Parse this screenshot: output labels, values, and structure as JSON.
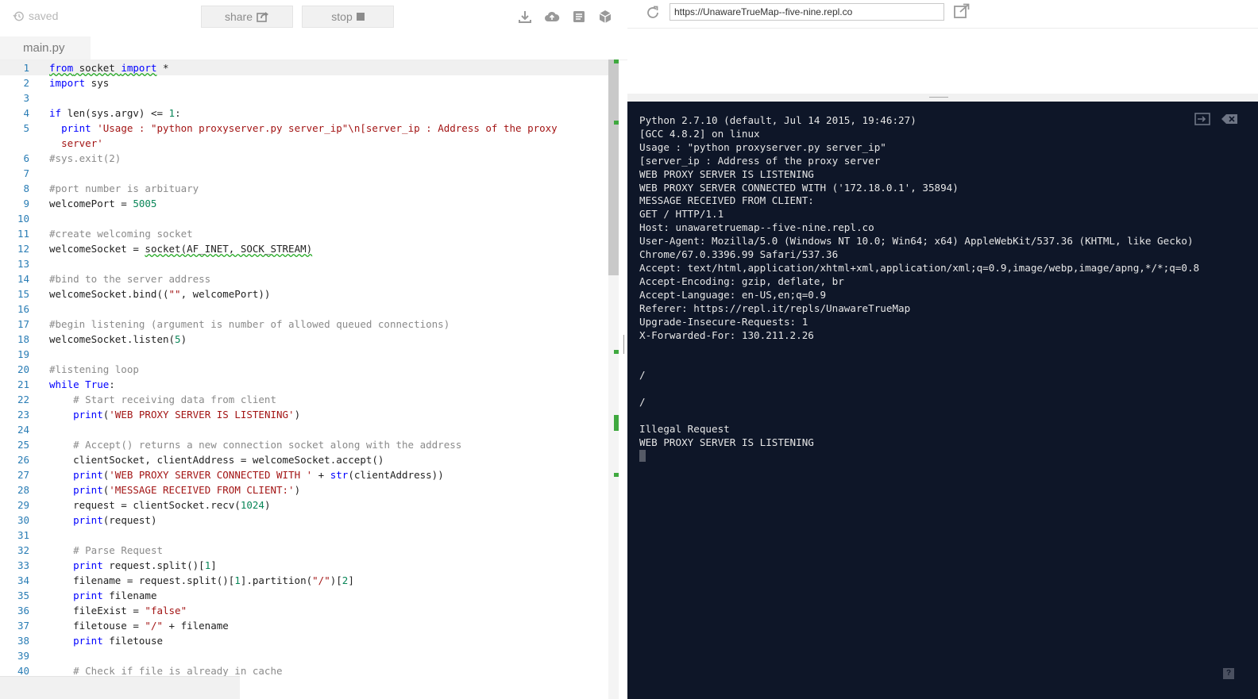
{
  "topbar": {
    "saved_label": "saved",
    "share_label": "share",
    "stop_label": "stop",
    "tools": [
      "download-icon",
      "cloud-upload-icon",
      "notes-icon",
      "package-icon"
    ]
  },
  "file_tab": {
    "label": "main.py"
  },
  "editor": {
    "lines": [
      {
        "n": "1",
        "h": "<span class=\"kw sq\">from</span><span class=\"sq\"> socket </span><span class=\"kw sq\">import</span> *"
      },
      {
        "n": "2",
        "h": "<span class=\"kw\">import</span> sys"
      },
      {
        "n": "3",
        "h": ""
      },
      {
        "n": "4",
        "h": "<span class=\"kw\">if</span> len(sys.argv) &lt;= <span class=\"nm\">1</span>:"
      },
      {
        "n": "5",
        "h": "  <span class=\"kw\">print</span> <span class=\"st\">'Usage : \"python proxyserver.py server_ip\"\\n[server_ip : Address of the proxy</span>"
      },
      {
        "n": "",
        "h": "  <span class=\"st\">server'</span>"
      },
      {
        "n": "6",
        "h": "<span class=\"cm\">#sys.exit(2)</span>"
      },
      {
        "n": "7",
        "h": ""
      },
      {
        "n": "8",
        "h": "<span class=\"cm\">#port number is arbituary</span>"
      },
      {
        "n": "9",
        "h": "welcomePort = <span class=\"nm\">5005</span>"
      },
      {
        "n": "10",
        "h": ""
      },
      {
        "n": "11",
        "h": "<span class=\"cm\">#create welcoming socket</span>"
      },
      {
        "n": "12",
        "h": "welcomeSocket = <span class=\"sq\">socket(AF_INET, SOCK_STREAM)</span>"
      },
      {
        "n": "13",
        "h": ""
      },
      {
        "n": "14",
        "h": "<span class=\"cm\">#bind to the server address</span>"
      },
      {
        "n": "15",
        "h": "welcomeSocket.bind((<span class=\"st\">\"\"</span>, welcomePort))"
      },
      {
        "n": "16",
        "h": ""
      },
      {
        "n": "17",
        "h": "<span class=\"cm\">#begin listening (argument is number of allowed queued connections)</span>"
      },
      {
        "n": "18",
        "h": "welcomeSocket.listen(<span class=\"nm\">5</span>)"
      },
      {
        "n": "19",
        "h": ""
      },
      {
        "n": "20",
        "h": "<span class=\"cm\">#listening loop</span>"
      },
      {
        "n": "21",
        "h": "<span class=\"kw\">while</span> <span class=\"kw\">True</span>:"
      },
      {
        "n": "22",
        "h": "    <span class=\"cm\"># Start receiving data from client</span>"
      },
      {
        "n": "23",
        "h": "    <span class=\"kw\">print</span>(<span class=\"st\">'WEB PROXY SERVER IS LISTENING'</span>)"
      },
      {
        "n": "24",
        "h": ""
      },
      {
        "n": "25",
        "h": "    <span class=\"cm\"># Accept() returns a new connection socket along with the address</span>"
      },
      {
        "n": "26",
        "h": "    clientSocket, clientAddress = welcomeSocket.accept()"
      },
      {
        "n": "27",
        "h": "    <span class=\"kw\">print</span>(<span class=\"st\">'WEB PROXY SERVER CONNECTED WITH '</span> + <span class=\"kw\">str</span>(clientAddress))"
      },
      {
        "n": "28",
        "h": "    <span class=\"kw\">print</span>(<span class=\"st\">'MESSAGE RECEIVED FROM CLIENT:'</span>)"
      },
      {
        "n": "29",
        "h": "    request = clientSocket.recv(<span class=\"nm\">1024</span>)"
      },
      {
        "n": "30",
        "h": "    <span class=\"kw\">print</span>(request)"
      },
      {
        "n": "31",
        "h": ""
      },
      {
        "n": "32",
        "h": "    <span class=\"cm\"># Parse Request</span>"
      },
      {
        "n": "33",
        "h": "    <span class=\"kw\">print</span> request.split()[<span class=\"nm\">1</span>]"
      },
      {
        "n": "34",
        "h": "    filename = request.split()[<span class=\"nm\">1</span>].partition(<span class=\"st\">\"/\"</span>)[<span class=\"nm\">2</span>]"
      },
      {
        "n": "35",
        "h": "    <span class=\"kw\">print</span> filename"
      },
      {
        "n": "36",
        "h": "    fileExist = <span class=\"st\">\"false\"</span>"
      },
      {
        "n": "37",
        "h": "    filetouse = <span class=\"st\">\"/\"</span> + filename"
      },
      {
        "n": "38",
        "h": "    <span class=\"kw\">print</span> filetouse"
      },
      {
        "n": "39",
        "h": ""
      },
      {
        "n": "40",
        "h": "    <span class=\"cm\"># Check if file is already in cache</span>"
      }
    ]
  },
  "webview": {
    "url": "https://UnawareTrueMap--five-nine.repl.co"
  },
  "console": {
    "output": "Python 2.7.10 (default, Jul 14 2015, 19:46:27)\n[GCC 4.8.2] on linux\nUsage : \"python proxyserver.py server_ip\"\n[server_ip : Address of the proxy server\nWEB PROXY SERVER IS LISTENING\nWEB PROXY SERVER CONNECTED WITH ('172.18.0.1', 35894)\nMESSAGE RECEIVED FROM CLIENT:\nGET / HTTP/1.1\nHost: unawaretruemap--five-nine.repl.co\nUser-Agent: Mozilla/5.0 (Windows NT 10.0; Win64; x64) AppleWebKit/537.36 (KHTML, like Gecko)\nChrome/67.0.3396.99 Safari/537.36\nAccept: text/html,application/xhtml+xml,application/xml;q=0.9,image/webp,image/apng,*/*;q=0.8\nAccept-Encoding: gzip, deflate, br\nAccept-Language: en-US,en;q=0.9\nReferer: https://repl.it/repls/UnawareTrueMap\nUpgrade-Insecure-Requests: 1\nX-Forwarded-For: 130.211.2.26\n\n\n/\n\n/\n\nIllegal Request\nWEB PROXY SERVER IS LISTENING\n",
    "help_label": "?"
  },
  "colors": {
    "console_bg": "#0e1628",
    "keyword": "#0000ff",
    "string": "#a31515",
    "number": "#098658",
    "comment": "#8a8a8a",
    "line_number": "#2a7db5",
    "change_marker": "#3fa93f"
  }
}
